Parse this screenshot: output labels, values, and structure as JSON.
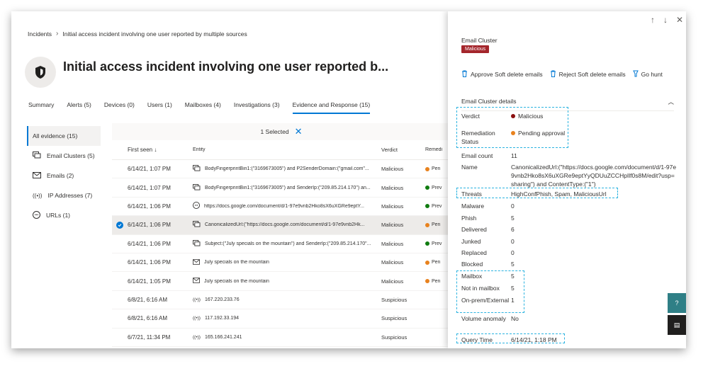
{
  "breadcrumb": {
    "root": "Incidents",
    "current": "Initial access incident involving one user reported by multiple sources"
  },
  "page_title": "Initial access incident involving one user reported b...",
  "tabs": [
    {
      "label": "Summary"
    },
    {
      "label": "Alerts (5)"
    },
    {
      "label": "Devices (0)"
    },
    {
      "label": "Users (1)"
    },
    {
      "label": "Mailboxes (4)"
    },
    {
      "label": "Investigations (3)"
    },
    {
      "label": "Evidence and Response (15)"
    }
  ],
  "leftnav": [
    {
      "label": "All evidence (15)",
      "icon": "none"
    },
    {
      "label": "Email Clusters (5)",
      "icon": "email-cluster-icon"
    },
    {
      "label": "Emails (2)",
      "icon": "mail-icon"
    },
    {
      "label": "IP Addresses (7)",
      "icon": "broadcast-icon"
    },
    {
      "label": "URLs (1)",
      "icon": "link-icon"
    }
  ],
  "table": {
    "selected_label": "1 Selected",
    "headers": {
      "first_seen": "First seen",
      "entity": "Entity",
      "verdict": "Verdict",
      "remediation": "Remedi"
    },
    "rows": [
      {
        "first_seen": "6/14/21, 1:07 PM",
        "icon": "email-cluster-icon",
        "entity": "BodyFingerprintBin1:(\"3169673005\") and P2SenderDomain:(\"gmail.com\"...",
        "verdict": "Malicious",
        "rem": "Pen",
        "rem_color": "#e8821e",
        "selected": false
      },
      {
        "first_seen": "6/14/21, 1:07 PM",
        "icon": "email-cluster-icon",
        "entity": "BodyFingerprintBin1:(\"3169673005\") and SenderIp:(\"209.85.214.170\") an...",
        "verdict": "Malicious",
        "rem": "Prev",
        "rem_color": "#107c10",
        "selected": false
      },
      {
        "first_seen": "6/14/21, 1:06 PM",
        "icon": "link-icon",
        "entity": "https://docs.google.com/document/d/1-97e9vnb2Hko8sX6uXGRe9eptY...",
        "verdict": "Malicious",
        "rem": "Prev",
        "rem_color": "#107c10",
        "selected": false
      },
      {
        "first_seen": "6/14/21, 1:06 PM",
        "icon": "email-cluster-icon",
        "entity": "CanonicalizedUrl:(\"https://docs.google.com/document/d/1-97e9vnb2Hk...",
        "verdict": "Malicious",
        "rem": "Pen",
        "rem_color": "#e8821e",
        "selected": true
      },
      {
        "first_seen": "6/14/21, 1:06 PM",
        "icon": "email-cluster-icon",
        "entity": "Subject:(\"July specials on the mountain\") and SenderIp:(\"209.85.214.170\"...",
        "verdict": "Malicious",
        "rem": "Prev",
        "rem_color": "#107c10",
        "selected": false
      },
      {
        "first_seen": "6/14/21, 1:06 PM",
        "icon": "mail-icon",
        "entity": "July specials on the mountain",
        "verdict": "Malicious",
        "rem": "Pen",
        "rem_color": "#e8821e",
        "selected": false
      },
      {
        "first_seen": "6/14/21, 1:05 PM",
        "icon": "mail-icon",
        "entity": "July specials on the mountain",
        "verdict": "Malicious",
        "rem": "Pen",
        "rem_color": "#e8821e",
        "selected": false
      },
      {
        "first_seen": "6/8/21, 6:16 AM",
        "icon": "broadcast-icon",
        "entity": "167.220.233.76",
        "verdict": "Suspicious",
        "rem": "",
        "rem_color": "",
        "selected": false
      },
      {
        "first_seen": "6/8/21, 6:16 AM",
        "icon": "broadcast-icon",
        "entity": "117.192.33.194",
        "verdict": "Suspicious",
        "rem": "",
        "rem_color": "",
        "selected": false
      },
      {
        "first_seen": "6/7/21, 11:34 PM",
        "icon": "broadcast-icon",
        "entity": "165.166.241.241",
        "verdict": "Suspicious",
        "rem": "",
        "rem_color": "",
        "selected": false
      }
    ]
  },
  "panel": {
    "type_label": "Email Cluster",
    "badge": "Malicious",
    "badge_color": "#a4262c",
    "actions": [
      {
        "label": "Approve Soft delete emails",
        "icon": "trash-icon"
      },
      {
        "label": "Reject Soft delete emails",
        "icon": "trash-icon"
      },
      {
        "label": "Go hunt",
        "icon": "hunt-icon"
      }
    ],
    "section_title": "Email Cluster details",
    "details": [
      {
        "key": "Verdict",
        "value": "Malicious",
        "dot": "#8b0f0f"
      },
      {
        "key": "Remediation Status",
        "value": "Pending approval",
        "dot": "#e8821e"
      },
      {
        "key": "Email count",
        "value": "11"
      },
      {
        "key": "Name",
        "value": "CanonicalizedUrl:(\"https://docs.google.com/document/d/1-97e9vnb2Hko8sX6uXGRe9eptYyQDUuZCCHpIlf0s8M/edit?usp=sharing\") and ContentType:(\"1\")"
      },
      {
        "key": "Threats",
        "value": "HighConfPhish, Spam, MaliciousUrl"
      },
      {
        "key": "Malware",
        "value": "0"
      },
      {
        "key": "Phish",
        "value": "5"
      },
      {
        "key": "Delivered",
        "value": "6"
      },
      {
        "key": "Junked",
        "value": "0"
      },
      {
        "key": "Replaced",
        "value": "0"
      },
      {
        "key": "Blocked",
        "value": "5"
      },
      {
        "key": "Mailbox",
        "value": "5"
      },
      {
        "key": "Not in mailbox",
        "value": "5"
      },
      {
        "key": "On-prem/External",
        "value": "1"
      },
      {
        "key": "Volume anomaly",
        "value": "No"
      },
      {
        "key": "Query Time",
        "value": "6/14/21, 1:18 PM"
      }
    ]
  },
  "colors": {
    "accent": "#0078d4",
    "annotation": "#2bb3e0",
    "side_button": "#2f7f86"
  }
}
